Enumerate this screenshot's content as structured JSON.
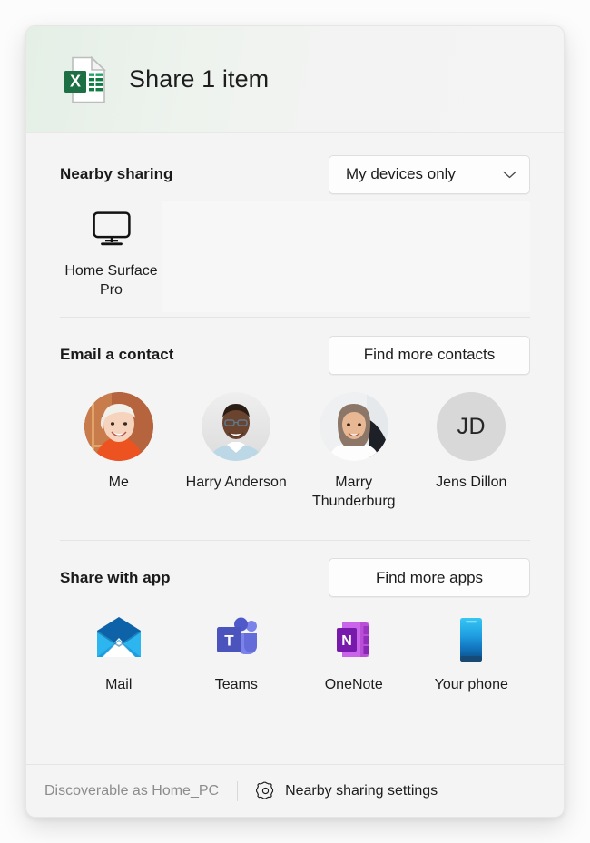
{
  "header": {
    "title": "Share 1 item",
    "file_icon": "excel-file-icon"
  },
  "nearby": {
    "title": "Nearby sharing",
    "dropdown_value": "My devices only",
    "dropdown_icon": "chevron-down-icon",
    "devices": [
      {
        "name": "Home Surface\nPro",
        "icon": "monitor-icon"
      }
    ]
  },
  "contacts": {
    "title": "Email a contact",
    "button_label": "Find more contacts",
    "items": [
      {
        "name": "Me",
        "avatar": "photo-blonde-woman",
        "initials": ""
      },
      {
        "name": "Harry Anderson",
        "avatar": "photo-man-glasses",
        "initials": ""
      },
      {
        "name": "Marry\nThunderburg",
        "avatar": "photo-woman-hijab",
        "initials": ""
      },
      {
        "name": "Jens Dillon",
        "avatar": "initials",
        "initials": "JD"
      }
    ]
  },
  "apps": {
    "title": "Share with app",
    "button_label": "Find more apps",
    "items": [
      {
        "name": "Mail",
        "icon": "mail-icon"
      },
      {
        "name": "Teams",
        "icon": "teams-icon"
      },
      {
        "name": "OneNote",
        "icon": "onenote-icon"
      },
      {
        "name": "Your phone",
        "icon": "your-phone-icon"
      }
    ]
  },
  "footer": {
    "discoverable_text": "Discoverable as Home_PC",
    "settings_label": "Nearby sharing settings",
    "settings_icon": "gear-icon"
  },
  "colors": {
    "excel_green": "#1d7044",
    "excel_green_light": "#21a366",
    "mail_blue": "#1f9cdd",
    "teams_purple": "#5b5fc7",
    "onenote_purple": "#7719aa",
    "phone_blue": "#2ab5f3",
    "surface": "#f4f4f4"
  }
}
